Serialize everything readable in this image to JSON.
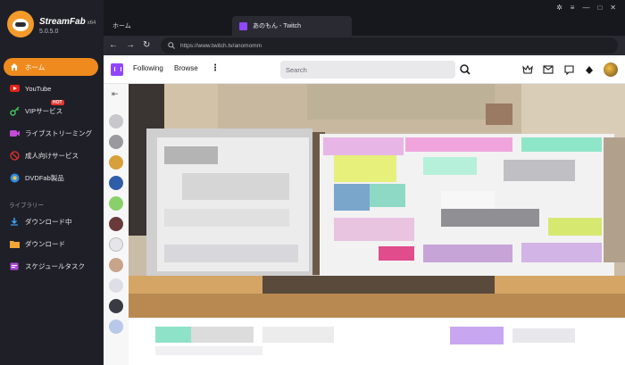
{
  "app": {
    "name": "StreamFab",
    "arch": "x64",
    "version": "5.0.5.0"
  },
  "sidebar": {
    "items": [
      {
        "label": "ホーム",
        "icon": "home-icon",
        "active": true
      },
      {
        "label": "YouTube",
        "icon": "youtube-icon"
      },
      {
        "label": "VIPサービス",
        "icon": "key-icon",
        "badge": "HOT"
      },
      {
        "label": "ライブストリーミング",
        "icon": "live-icon"
      },
      {
        "label": "成人向けサービス",
        "icon": "adult-icon"
      },
      {
        "label": "DVDFab製品",
        "icon": "dvdfab-icon"
      }
    ],
    "library_label": "ライブラリー",
    "library_items": [
      {
        "label": "ダウンロード中",
        "icon": "downloading-icon"
      },
      {
        "label": "ダウンロード",
        "icon": "folder-icon"
      },
      {
        "label": "スケジュールタスク",
        "icon": "schedule-icon"
      }
    ]
  },
  "tabs": {
    "home": "ホーム",
    "twitch": "あのもん - Twitch"
  },
  "address": {
    "url": "https://www.twitch.tv/anomomm"
  },
  "twitch": {
    "following": "Following",
    "browse": "Browse",
    "search_placeholder": "Search"
  },
  "colors": {
    "accent": "#ef8a1e",
    "twitch_purple": "#9146ff",
    "sidebar_bg": "#1f2027"
  }
}
